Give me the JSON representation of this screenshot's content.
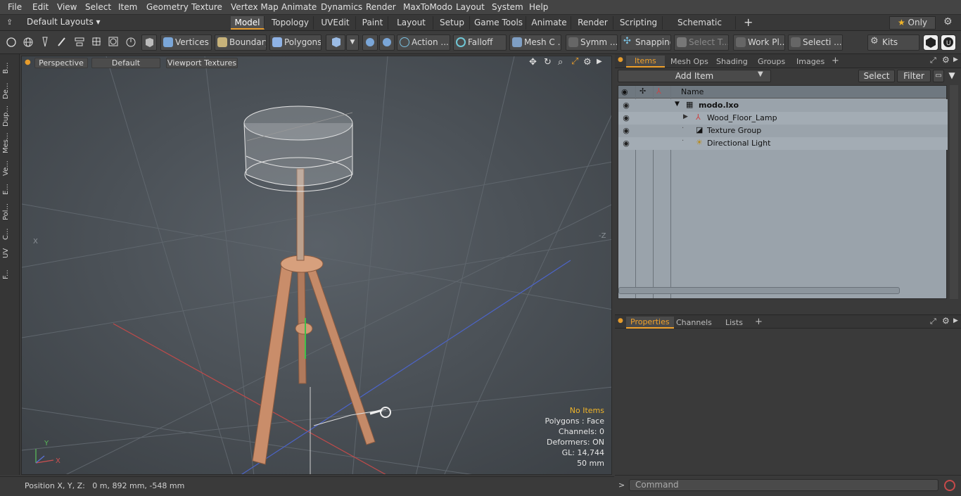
{
  "menu": [
    "File",
    "Edit",
    "View",
    "Select",
    "Item",
    "Geometry",
    "Texture",
    "Vertex Map",
    "Animate",
    "Dynamics",
    "Render",
    "MaxToModo",
    "Layout",
    "System",
    "Help"
  ],
  "layout_selector": "Default Layouts",
  "layout_tabs": [
    "Model",
    "Topology",
    "UVEdit",
    "Paint",
    "Layout",
    "Setup",
    "Game Tools",
    "Animate",
    "Render",
    "Scripting",
    "Schematic Fusion"
  ],
  "active_layout_tab": "Model",
  "only_label": "Only",
  "toolbar": {
    "vertices": "Vertices",
    "boundary": "Boundary",
    "polygons": "Polygons",
    "action": "Action",
    "falloff": "Falloff",
    "mesh": "Mesh C ...",
    "symm": "Symm ...",
    "snapping": "Snapping",
    "select_t": "Select T...",
    "work_pl": "Work Pl...",
    "selecti": "Selecti ...",
    "kits": "Kits"
  },
  "left_tools": [
    "B...",
    "De...",
    "Dup...",
    "Mes...",
    "Ve...",
    "E...",
    "Pol...",
    "C...",
    "UV",
    "F..."
  ],
  "viewport": {
    "view": "Perspective",
    "shading": "Default",
    "textures": "Viewport Textures",
    "axis_x_label": "X",
    "axis_z_label": "-Z",
    "hud": {
      "items": "No Items",
      "polygons": "Polygons : Face",
      "channels": "Channels: 0",
      "deformers": "Deformers: ON",
      "gl": "GL: 14,744",
      "dist": "50 mm"
    }
  },
  "status": {
    "position": "Position X, Y, Z:   0 m, 892 mm, -548 mm"
  },
  "items_panel": {
    "tabs": [
      "Items",
      "Mesh Ops",
      "Shading",
      "Groups",
      "Images"
    ],
    "add_item": "Add Item",
    "select": "Select",
    "filter": "Filter",
    "name_header": "Name",
    "tree": [
      {
        "label": "modo.lxo",
        "level": 0
      },
      {
        "label": "Wood_Floor_Lamp",
        "level": 1
      },
      {
        "label": "Texture Group",
        "level": 1
      },
      {
        "label": "Directional Light",
        "level": 1
      }
    ]
  },
  "props_panel": {
    "tabs": [
      "Properties",
      "Channels",
      "Lists"
    ]
  },
  "command_placeholder": "Command",
  "colors": {
    "accent": "#f0a12b",
    "viewport_bg": "#4b5157",
    "tree_bg": "#9aa3ab"
  }
}
